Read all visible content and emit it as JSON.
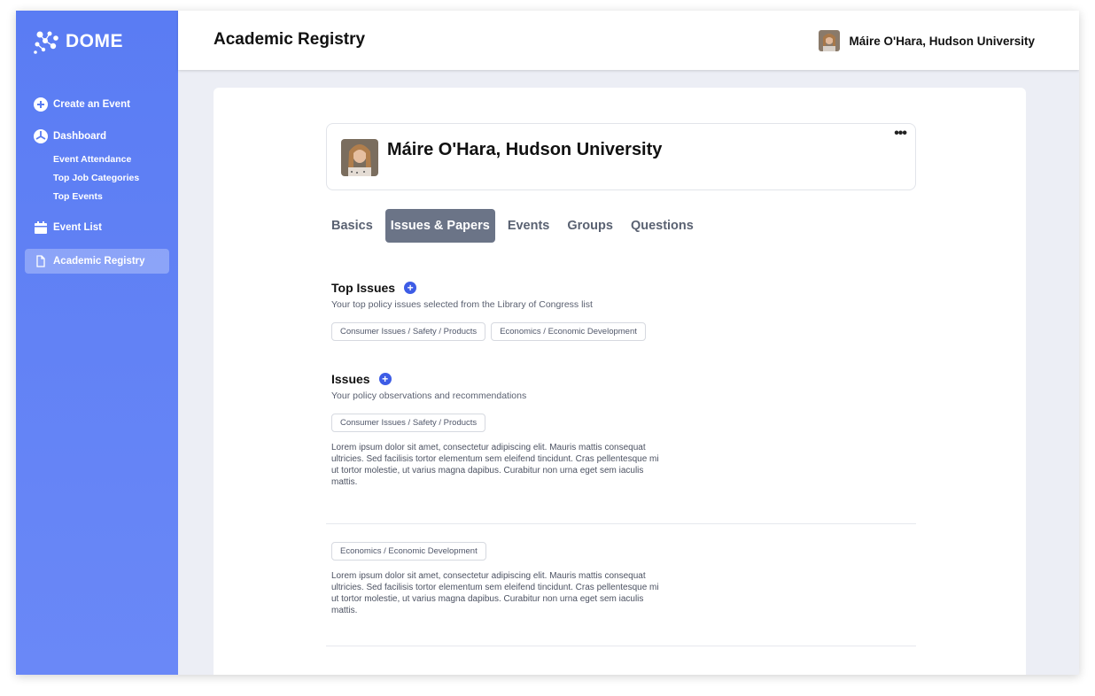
{
  "app": {
    "logo_text": "DOME",
    "page_title": "Academic Registry"
  },
  "header": {
    "user_name": "Máire O'Hara, Hudson University"
  },
  "sidebar": {
    "create": "Create an Event",
    "dashboard": "Dashboard",
    "dashboard_items": [
      "Event Attendance",
      "Top Job Categories",
      "Top Events"
    ],
    "event_list": "Event List",
    "academic_registry": "Academic Registry"
  },
  "profile": {
    "name": "Máire O'Hara, Hudson University",
    "more_label": "•••"
  },
  "tabs": [
    {
      "label": "Basics",
      "active": false
    },
    {
      "label": "Issues & Papers",
      "active": true
    },
    {
      "label": "Events",
      "active": false
    },
    {
      "label": "Groups",
      "active": false
    },
    {
      "label": "Questions",
      "active": false
    }
  ],
  "top_issues": {
    "title": "Top Issues",
    "description": "Your top policy issues selected from the Library of Congress list",
    "tags": [
      "Consumer Issues / Safety / Products",
      "Economics / Economic Development"
    ]
  },
  "issues": {
    "title": "Issues",
    "description": "Your policy observations and recommendations",
    "entries": [
      {
        "tag": "Consumer Issues / Safety / Products",
        "text": "Lorem ipsum dolor sit amet, consectetur adipiscing elit. Mauris mattis consequat ultricies. Sed facilisis tortor elementum sem eleifend tincidunt. Cras pellentesque mi ut tortor molestie, ut varius magna dapibus. Curabitur non urna eget sem iaculis mattis."
      },
      {
        "tag": "Economics / Economic Development",
        "text": "Lorem ipsum dolor sit amet, consectetur adipiscing elit. Mauris mattis consequat ultricies. Sed facilisis tortor elementum sem eleifend tincidunt. Cras pellentesque mi ut tortor molestie, ut varius magna dapibus. Curabitur non urna eget sem iaculis mattis."
      }
    ]
  },
  "colors": {
    "sidebar": "#5a7cf3",
    "accent": "#3d5ce6",
    "active_tab": "#6b7487"
  }
}
